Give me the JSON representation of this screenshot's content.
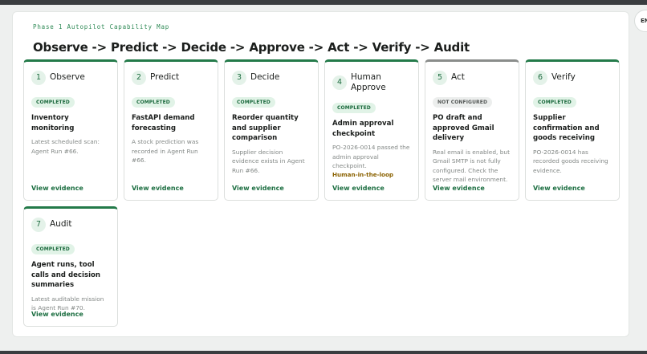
{
  "header": {
    "eyebrow": "Phase 1 Autopilot Capability Map",
    "title": "Observe -> Predict -> Decide -> Approve -> Act -> Verify -> Audit",
    "language_label": "EN"
  },
  "colors": {
    "accent": "#237a49",
    "badge_completed_bg": "#e1f3e7",
    "badge_neutral_bg": "#eceeed",
    "hitl": "#8a6100"
  },
  "cards": [
    {
      "number": "1",
      "title": "Observe",
      "status": "COMPLETED",
      "heading": "Inventory monitoring",
      "description": "Latest scheduled scan: Agent Run #66.",
      "link": "View evidence"
    },
    {
      "number": "2",
      "title": "Predict",
      "status": "COMPLETED",
      "heading": "FastAPI demand forecasting",
      "description": "A stock prediction was recorded in Agent Run #66.",
      "link": "View evidence"
    },
    {
      "number": "3",
      "title": "Decide",
      "status": "COMPLETED",
      "heading": "Reorder quantity and supplier comparison",
      "description": "Supplier decision evidence exists in Agent Run #66.",
      "link": "View evidence"
    },
    {
      "number": "4",
      "title": "Human Approve",
      "status": "COMPLETED",
      "heading": "Admin approval checkpoint",
      "description": "PO-2026-0014 passed the admin approval checkpoint.",
      "tag": "Human-in-the-loop",
      "link": "View evidence"
    },
    {
      "number": "5",
      "title": "Act",
      "status": "NOT CONFIGURED",
      "heading": "PO draft and approved Gmail delivery",
      "description": "Real email is enabled, but Gmail SMTP is not fully configured. Check the server mail environment.",
      "link": "View evidence"
    },
    {
      "number": "6",
      "title": "Verify",
      "status": "COMPLETED",
      "heading": "Supplier confirmation and goods receiving",
      "description": "PO-2026-0014 has recorded goods receiving evidence.",
      "link": "View evidence"
    },
    {
      "number": "7",
      "title": "Audit",
      "status": "COMPLETED",
      "heading": "Agent runs, tool calls and decision summaries",
      "description": "Latest auditable mission is Agent Run #70.",
      "link": "View evidence"
    }
  ]
}
